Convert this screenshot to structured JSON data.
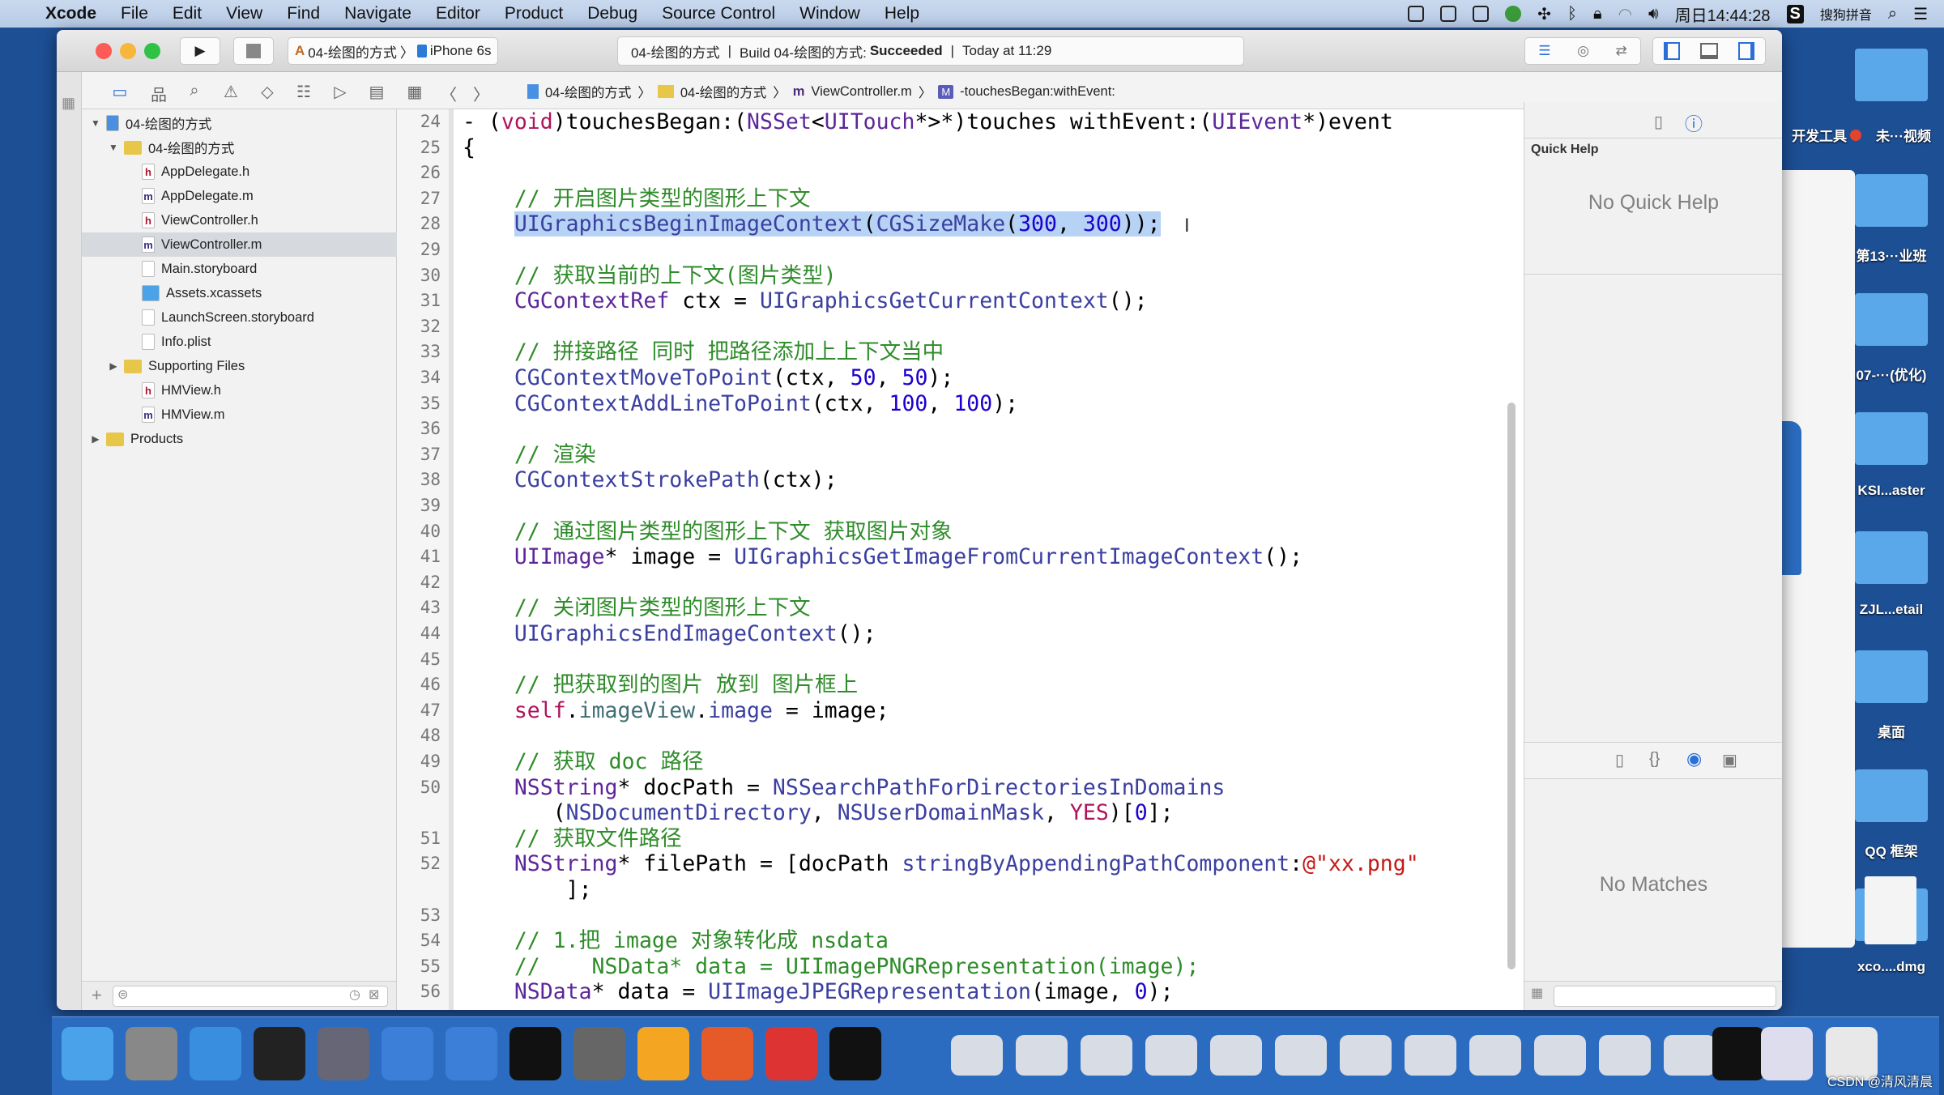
{
  "menubar": {
    "app": "Xcode",
    "items": [
      "File",
      "Edit",
      "View",
      "Find",
      "Navigate",
      "Editor",
      "Product",
      "Debug",
      "Source Control",
      "Window",
      "Help"
    ],
    "clock": "周日14:44:28",
    "ime": "搜狗拼音"
  },
  "toolbar": {
    "scheme": "04-绘图的方式",
    "device": "iPhone 6s",
    "activity": {
      "project": "04-绘图的方式",
      "build_prefix": "Build 04-绘图的方式:",
      "build_status": "Succeeded",
      "time": "Today at 11:29"
    }
  },
  "jumpbar": [
    "04-绘图的方式",
    "04-绘图的方式",
    "ViewController.m",
    "-touchesBegan:withEvent:"
  ],
  "navigator": {
    "items": [
      {
        "label": "04-绘图的方式",
        "type": "project",
        "level": 0,
        "disc": "▼"
      },
      {
        "label": "04-绘图的方式",
        "type": "folder",
        "level": 1,
        "disc": "▼"
      },
      {
        "label": "AppDelegate.h",
        "type": "h",
        "level": 2
      },
      {
        "label": "AppDelegate.m",
        "type": "m",
        "level": 2
      },
      {
        "label": "ViewController.h",
        "type": "h",
        "level": 2
      },
      {
        "label": "ViewController.m",
        "type": "m",
        "level": 2,
        "selected": true
      },
      {
        "label": "Main.storyboard",
        "type": "sb",
        "level": 2
      },
      {
        "label": "Assets.xcassets",
        "type": "assets",
        "level": 2
      },
      {
        "label": "LaunchScreen.storyboard",
        "type": "sb",
        "level": 2
      },
      {
        "label": "Info.plist",
        "type": "plist",
        "level": 2
      },
      {
        "label": "Supporting Files",
        "type": "folder",
        "level": 1,
        "disc": "▶"
      },
      {
        "label": "HMView.h",
        "type": "h",
        "level": 2
      },
      {
        "label": "HMView.m",
        "type": "m",
        "level": 2
      },
      {
        "label": "Products",
        "type": "folder",
        "level": 0,
        "disc": "▶"
      }
    ]
  },
  "code": [
    {
      "n": "24",
      "t": [
        [
          "p",
          "- ("
        ],
        [
          "k",
          "void"
        ],
        [
          "p",
          ")touchesBegan:("
        ],
        [
          "t",
          "NSSet"
        ],
        [
          "p",
          "<"
        ],
        [
          "t",
          "UITouch"
        ],
        [
          "p",
          "*>*)touches withEvent:("
        ],
        [
          "t",
          "UIEvent"
        ],
        [
          "p",
          "*)event"
        ]
      ]
    },
    {
      "n": "25",
      "t": [
        [
          "p",
          "{"
        ]
      ]
    },
    {
      "n": "26",
      "t": []
    },
    {
      "n": "27",
      "t": [
        [
          "c",
          "    // 开启图片类型的图形上下文"
        ]
      ]
    },
    {
      "n": "28",
      "hl": true,
      "t": [
        [
          "p",
          "    "
        ],
        [
          "f",
          "UIGraphicsBeginImageContext"
        ],
        [
          "p",
          "("
        ],
        [
          "f",
          "CGSizeMake"
        ],
        [
          "p",
          "("
        ],
        [
          "n",
          "300"
        ],
        [
          "p",
          ", "
        ],
        [
          "n",
          "300"
        ],
        [
          "p",
          "));"
        ]
      ]
    },
    {
      "n": "29",
      "t": []
    },
    {
      "n": "30",
      "t": [
        [
          "c",
          "    // 获取当前的上下文(图片类型)"
        ]
      ]
    },
    {
      "n": "31",
      "t": [
        [
          "p",
          "    "
        ],
        [
          "t",
          "CGContextRef"
        ],
        [
          "p",
          " ctx = "
        ],
        [
          "f",
          "UIGraphicsGetCurrentContext"
        ],
        [
          "p",
          "();"
        ]
      ]
    },
    {
      "n": "32",
      "t": []
    },
    {
      "n": "33",
      "t": [
        [
          "c",
          "    // 拼接路径 同时 把路径添加上上下文当中"
        ]
      ]
    },
    {
      "n": "34",
      "t": [
        [
          "p",
          "    "
        ],
        [
          "f",
          "CGContextMoveToPoint"
        ],
        [
          "p",
          "(ctx, "
        ],
        [
          "n",
          "50"
        ],
        [
          "p",
          ", "
        ],
        [
          "n",
          "50"
        ],
        [
          "p",
          ");"
        ]
      ]
    },
    {
      "n": "35",
      "t": [
        [
          "p",
          "    "
        ],
        [
          "f",
          "CGContextAddLineToPoint"
        ],
        [
          "p",
          "(ctx, "
        ],
        [
          "n",
          "100"
        ],
        [
          "p",
          ", "
        ],
        [
          "n",
          "100"
        ],
        [
          "p",
          ");"
        ]
      ]
    },
    {
      "n": "36",
      "t": []
    },
    {
      "n": "37",
      "t": [
        [
          "c",
          "    // 渲染"
        ]
      ]
    },
    {
      "n": "38",
      "t": [
        [
          "p",
          "    "
        ],
        [
          "f",
          "CGContextStrokePath"
        ],
        [
          "p",
          "(ctx);"
        ]
      ]
    },
    {
      "n": "39",
      "t": []
    },
    {
      "n": "40",
      "t": [
        [
          "c",
          "    // 通过图片类型的图形上下文 获取图片对象"
        ]
      ]
    },
    {
      "n": "41",
      "t": [
        [
          "p",
          "    "
        ],
        [
          "t",
          "UIImage"
        ],
        [
          "p",
          "* image = "
        ],
        [
          "f",
          "UIGraphicsGetImageFromCurrentImageContext"
        ],
        [
          "p",
          "();"
        ]
      ]
    },
    {
      "n": "42",
      "t": []
    },
    {
      "n": "43",
      "t": [
        [
          "c",
          "    // 关闭图片类型的图形上下文"
        ]
      ]
    },
    {
      "n": "44",
      "t": [
        [
          "p",
          "    "
        ],
        [
          "f",
          "UIGraphicsEndImageContext"
        ],
        [
          "p",
          "();"
        ]
      ]
    },
    {
      "n": "45",
      "t": []
    },
    {
      "n": "46",
      "t": [
        [
          "c",
          "    // 把获取到的图片 放到 图片框上"
        ]
      ]
    },
    {
      "n": "47",
      "t": [
        [
          "p",
          "    "
        ],
        [
          "k",
          "self"
        ],
        [
          "p",
          "."
        ],
        [
          "m",
          "imageView"
        ],
        [
          "p",
          "."
        ],
        [
          "f",
          "image"
        ],
        [
          "p",
          " = image;"
        ]
      ]
    },
    {
      "n": "48",
      "t": []
    },
    {
      "n": "49",
      "t": [
        [
          "c",
          "    // 获取 doc 路径"
        ]
      ]
    },
    {
      "n": "50",
      "t": [
        [
          "p",
          "    "
        ],
        [
          "t",
          "NSString"
        ],
        [
          "p",
          "* docPath = "
        ],
        [
          "f",
          "NSSearchPathForDirectoriesInDomains"
        ]
      ]
    },
    {
      "n": "",
      "t": [
        [
          "p",
          "       ("
        ],
        [
          "f",
          "NSDocumentDirectory"
        ],
        [
          "p",
          ", "
        ],
        [
          "f",
          "NSUserDomainMask"
        ],
        [
          "p",
          ", "
        ],
        [
          "k",
          "YES"
        ],
        [
          "p",
          ")["
        ],
        [
          "n",
          "0"
        ],
        [
          "p",
          "];"
        ]
      ]
    },
    {
      "n": "51",
      "t": [
        [
          "c",
          "    // 获取文件路径"
        ]
      ]
    },
    {
      "n": "52",
      "t": [
        [
          "p",
          "    "
        ],
        [
          "t",
          "NSString"
        ],
        [
          "p",
          "* filePath = [docPath "
        ],
        [
          "f",
          "stringByAppendingPathComponent"
        ],
        [
          "p",
          ":"
        ],
        [
          "s",
          "@\"xx.png\""
        ]
      ]
    },
    {
      "n": "",
      "t": [
        [
          "p",
          "        ];"
        ]
      ]
    },
    {
      "n": "53",
      "t": []
    },
    {
      "n": "54",
      "t": [
        [
          "c",
          "    // 1.把 image 对象转化成 nsdata"
        ]
      ]
    },
    {
      "n": "55",
      "t": [
        [
          "c",
          "    //    NSData* data = UIImagePNGRepresentation(image);"
        ]
      ]
    },
    {
      "n": "56",
      "t": [
        [
          "p",
          "    "
        ],
        [
          "t",
          "NSData"
        ],
        [
          "p",
          "* data = "
        ],
        [
          "f",
          "UIImageJPEGRepresentation"
        ],
        [
          "p",
          "(image, "
        ],
        [
          "n",
          "0"
        ],
        [
          "p",
          ");"
        ]
      ]
    }
  ],
  "inspector": {
    "title": "Quick Help",
    "no_help": "No Quick Help",
    "no_matches": "No Matches"
  },
  "desktop": [
    "开发工具",
    "未···视频",
    "第13···业班",
    "07-···(优化)",
    "KSI...aster",
    "ZJL...etail",
    "桌面",
    "QQ 框架",
    "xco....dmg"
  ],
  "watermark": "CSDN @清风清晨",
  "colors": {
    "desktop": "#1d4f95",
    "selection": "#b6d2f4",
    "comment": "#2f8c2a",
    "keyword": "#b0125a",
    "number": "#1c00cf",
    "string": "#c41a16"
  }
}
